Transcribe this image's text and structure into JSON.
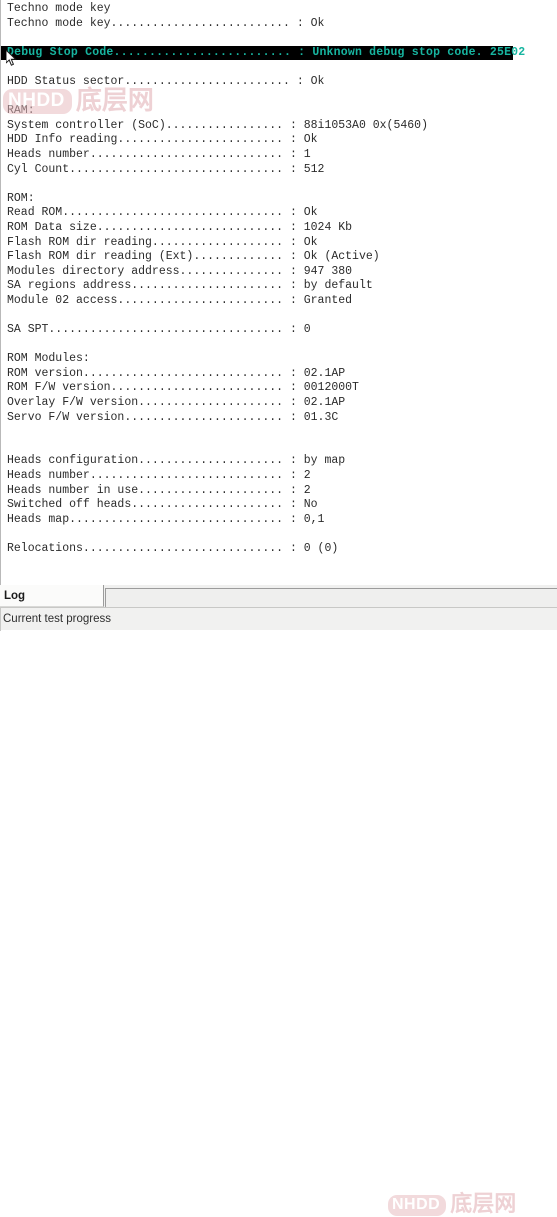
{
  "log": {
    "lines": [
      {
        "text": "Techno mode key",
        "style": "normal"
      },
      {
        "text": "Techno mode key.......................... : Ok",
        "style": "normal"
      },
      {
        "text": "",
        "style": "blank"
      },
      {
        "text": "Debug Stop Code......................... : Unknown debug stop code. 25E02",
        "style": "highlight"
      },
      {
        "text": "",
        "style": "blank"
      },
      {
        "text": "HDD Status sector........................ : Ok",
        "style": "normal"
      },
      {
        "text": "",
        "style": "blank"
      },
      {
        "text": "RAM:",
        "style": "normal"
      },
      {
        "text": "System controller (SoC)................. : 88i1053A0 0x(5460)",
        "style": "normal"
      },
      {
        "text": "HDD Info reading........................ : Ok",
        "style": "normal"
      },
      {
        "text": "Heads number............................ : 1",
        "style": "normal"
      },
      {
        "text": "Cyl Count............................... : 512",
        "style": "normal"
      },
      {
        "text": "",
        "style": "blank"
      },
      {
        "text": "ROM:",
        "style": "normal"
      },
      {
        "text": "Read ROM................................ : Ok",
        "style": "normal"
      },
      {
        "text": "ROM Data size........................... : 1024 Kb",
        "style": "normal"
      },
      {
        "text": "Flash ROM dir reading................... : Ok",
        "style": "normal"
      },
      {
        "text": "Flash ROM dir reading (Ext)............. : Ok (Active)",
        "style": "normal"
      },
      {
        "text": "Modules directory address............... : 947 380",
        "style": "normal"
      },
      {
        "text": "SA regions address...................... : by default",
        "style": "normal"
      },
      {
        "text": "Module 02 access........................ : Granted",
        "style": "normal"
      },
      {
        "text": "",
        "style": "blank"
      },
      {
        "text": "SA SPT.................................. : 0",
        "style": "normal"
      },
      {
        "text": "",
        "style": "blank"
      },
      {
        "text": "ROM Modules:",
        "style": "normal"
      },
      {
        "text": "ROM version............................. : 02.1AP",
        "style": "normal"
      },
      {
        "text": "ROM F/W version......................... : 0012000T",
        "style": "normal"
      },
      {
        "text": "Overlay F/W version..................... : 02.1AP",
        "style": "normal"
      },
      {
        "text": "Servo F/W version....................... : 01.3C",
        "style": "normal"
      },
      {
        "text": "",
        "style": "blank"
      },
      {
        "text": "",
        "style": "blank"
      },
      {
        "text": "Heads configuration..................... : by map",
        "style": "normal"
      },
      {
        "text": "Heads number............................ : 2",
        "style": "normal"
      },
      {
        "text": "Heads number in use..................... : 2",
        "style": "normal"
      },
      {
        "text": "Switched off heads...................... : No",
        "style": "normal"
      },
      {
        "text": "Heads map............................... : 0,1",
        "style": "normal"
      },
      {
        "text": "",
        "style": "blank"
      },
      {
        "text": "Relocations............................. : 0 (0)",
        "style": "normal"
      }
    ],
    "highlight_bg": "#000000",
    "highlight_fg": "#17b5a0",
    "text_color": "#2b2b2b"
  },
  "tabs": {
    "log_label": "Log"
  },
  "status": {
    "text": "Current test progress"
  },
  "watermark": {
    "badge": "NHDD",
    "cn": "底层网",
    "badge_color": "#e8b9bd",
    "cn_color": "#e0a9ae"
  }
}
